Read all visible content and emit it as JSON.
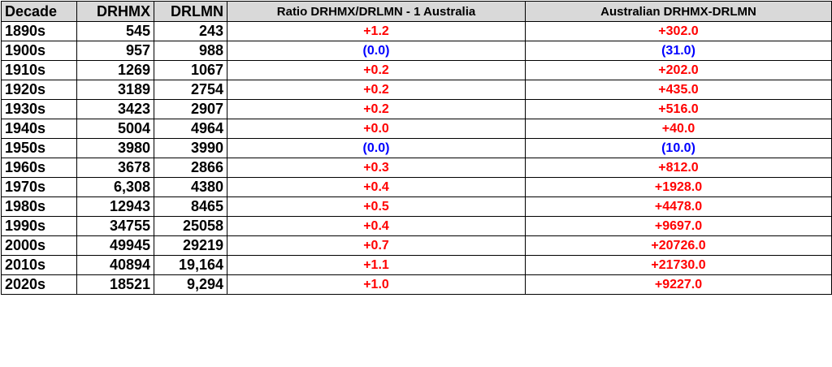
{
  "chart_data": {
    "type": "table",
    "columns": [
      "Decade",
      "DRHMX",
      "DRLMN",
      "Ratio DRHMX/DRLMN - 1 Australia",
      "Australian DRHMX-DRLMN"
    ],
    "rows": [
      {
        "decade": "1890s",
        "drhmx": "545",
        "drlmn": "243",
        "ratio": "+1.2",
        "diff": "+302.0"
      },
      {
        "decade": "1900s",
        "drhmx": "957",
        "drlmn": "988",
        "ratio": "(0.0)",
        "diff": "(31.0)"
      },
      {
        "decade": "1910s",
        "drhmx": "1269",
        "drlmn": "1067",
        "ratio": "+0.2",
        "diff": "+202.0"
      },
      {
        "decade": "1920s",
        "drhmx": "3189",
        "drlmn": "2754",
        "ratio": "+0.2",
        "diff": "+435.0"
      },
      {
        "decade": "1930s",
        "drhmx": "3423",
        "drlmn": "2907",
        "ratio": "+0.2",
        "diff": "+516.0"
      },
      {
        "decade": "1940s",
        "drhmx": "5004",
        "drlmn": "4964",
        "ratio": "+0.0",
        "diff": "+40.0"
      },
      {
        "decade": "1950s",
        "drhmx": "3980",
        "drlmn": "3990",
        "ratio": "(0.0)",
        "diff": "(10.0)"
      },
      {
        "decade": "1960s",
        "drhmx": "3678",
        "drlmn": "2866",
        "ratio": "+0.3",
        "diff": "+812.0"
      },
      {
        "decade": "1970s",
        "drhmx": "6,308",
        "drlmn": "4380",
        "ratio": "+0.4",
        "diff": "+1928.0"
      },
      {
        "decade": "1980s",
        "drhmx": "12943",
        "drlmn": "8465",
        "ratio": "+0.5",
        "diff": "+4478.0"
      },
      {
        "decade": "1990s",
        "drhmx": "34755",
        "drlmn": "25058",
        "ratio": "+0.4",
        "diff": "+9697.0"
      },
      {
        "decade": "2000s",
        "drhmx": "49945",
        "drlmn": "29219",
        "ratio": "+0.7",
        "diff": "+20726.0"
      },
      {
        "decade": "2010s",
        "drhmx": "40894",
        "drlmn": "19,164",
        "ratio": "+1.1",
        "diff": "+21730.0"
      },
      {
        "decade": "2020s",
        "drhmx": "18521",
        "drlmn": "9,294",
        "ratio": "+1.0",
        "diff": "+9227.0"
      }
    ]
  },
  "colors": {
    "header_bg": "#d9d9d9",
    "positive": "#ff0000",
    "negative": "#0000ff",
    "text": "#000000",
    "border": "#000000"
  }
}
